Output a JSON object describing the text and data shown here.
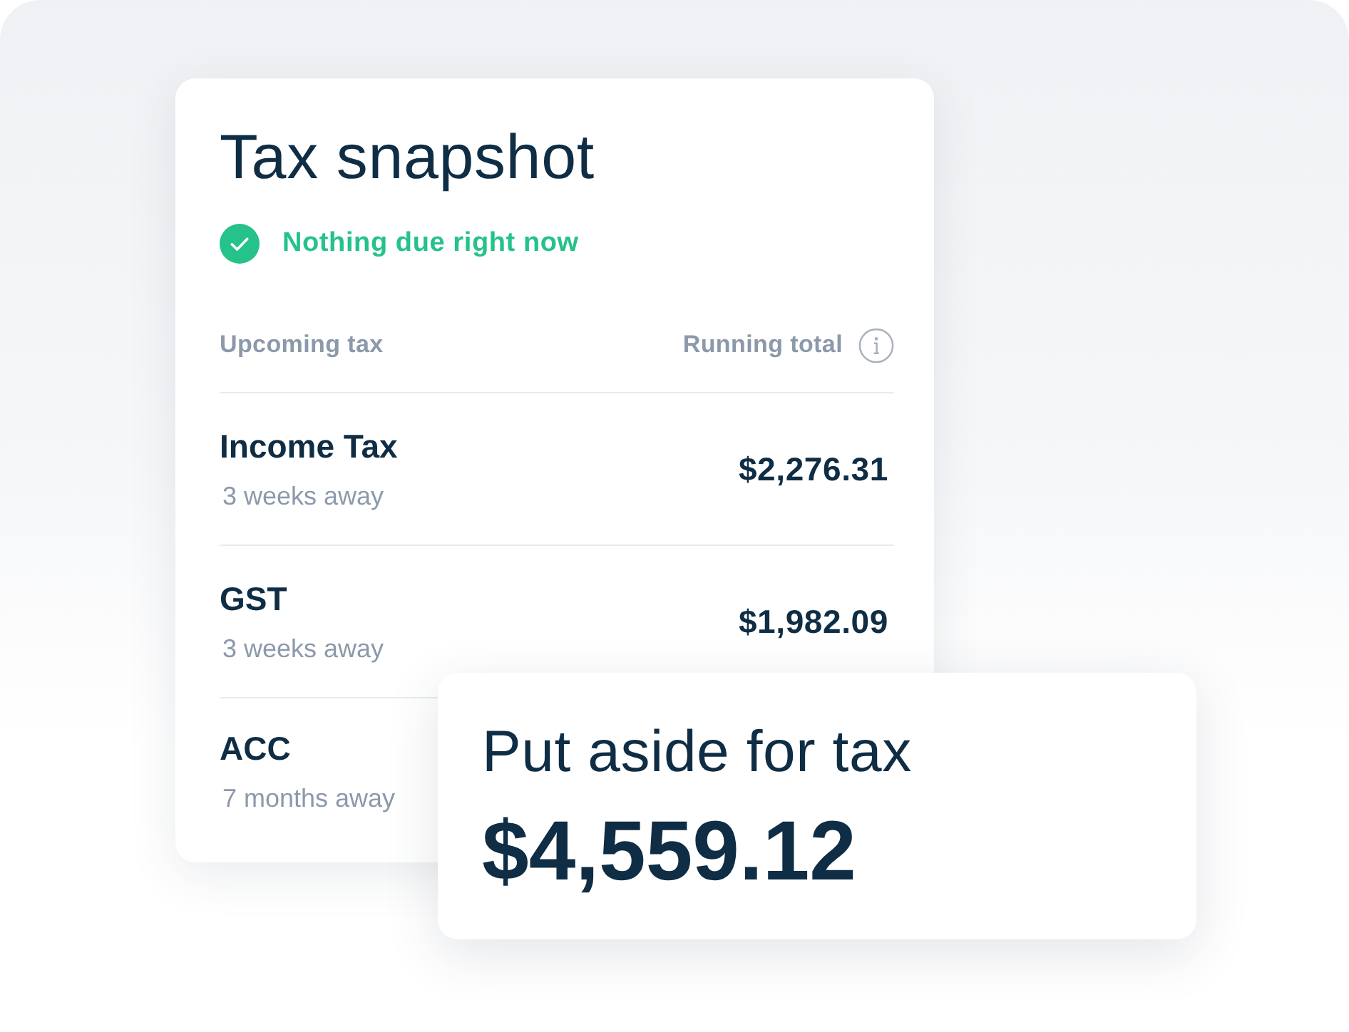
{
  "title": "Tax snapshot",
  "status": {
    "kind": "ok",
    "text": "Nothing due right now"
  },
  "table": {
    "columns": [
      "Upcoming tax",
      "Running total"
    ],
    "rows": [
      {
        "name": "Income Tax",
        "due": "3 weeks away",
        "amount": "$2,276.31"
      },
      {
        "name": "GST",
        "due": "3 weeks away",
        "amount": "$1,982.09"
      },
      {
        "name": "ACC",
        "due": "7 months away"
      }
    ]
  },
  "summary": {
    "label": "Put aside for tax",
    "amount": "$4,559.12"
  }
}
